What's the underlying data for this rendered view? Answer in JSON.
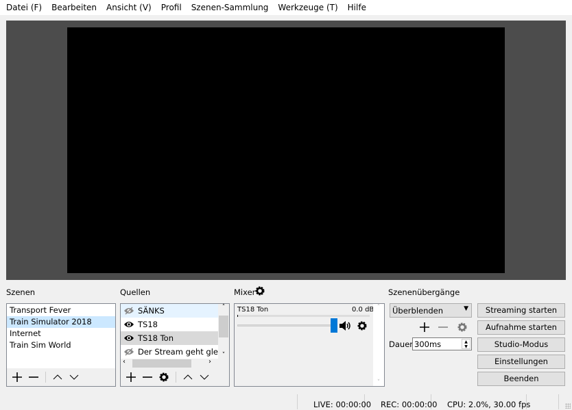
{
  "menu": [
    "Datei (F)",
    "Bearbeiten",
    "Ansicht (V)",
    "Profil",
    "Szenen-Sammlung",
    "Werkzeuge (T)",
    "Hilfe"
  ],
  "scenes": {
    "title": "Szenen",
    "items": [
      "Transport Fever",
      "Train Simulator 2018",
      "Internet",
      "Train Sim World"
    ],
    "selected": 1
  },
  "sources": {
    "title": "Quellen",
    "items": [
      {
        "label": "SÄNKS",
        "visible": false
      },
      {
        "label": "TS18",
        "visible": true
      },
      {
        "label": "TS18 Ton",
        "visible": true
      },
      {
        "label": "Der Stream geht gleich w",
        "visible": false
      }
    ]
  },
  "mixer": {
    "title": "Mixer",
    "channel": "TS18 Ton",
    "level": "0.0 dB",
    "volume": 1.0
  },
  "transitions": {
    "title": "Szenenübergänge",
    "selected": "Überblenden",
    "duration_label": "Dauer",
    "duration": "300ms"
  },
  "controls": [
    "Streaming starten",
    "Aufnahme starten",
    "Studio-Modus",
    "Einstellungen",
    "Beenden"
  ],
  "status": {
    "live": "LIVE: 00:00:00",
    "rec": "REC: 00:00:00",
    "cpu": "CPU: 2.0%, 30.00 fps"
  },
  "colors": {
    "accent": "#0078d7",
    "selected": "#cce8ff"
  }
}
